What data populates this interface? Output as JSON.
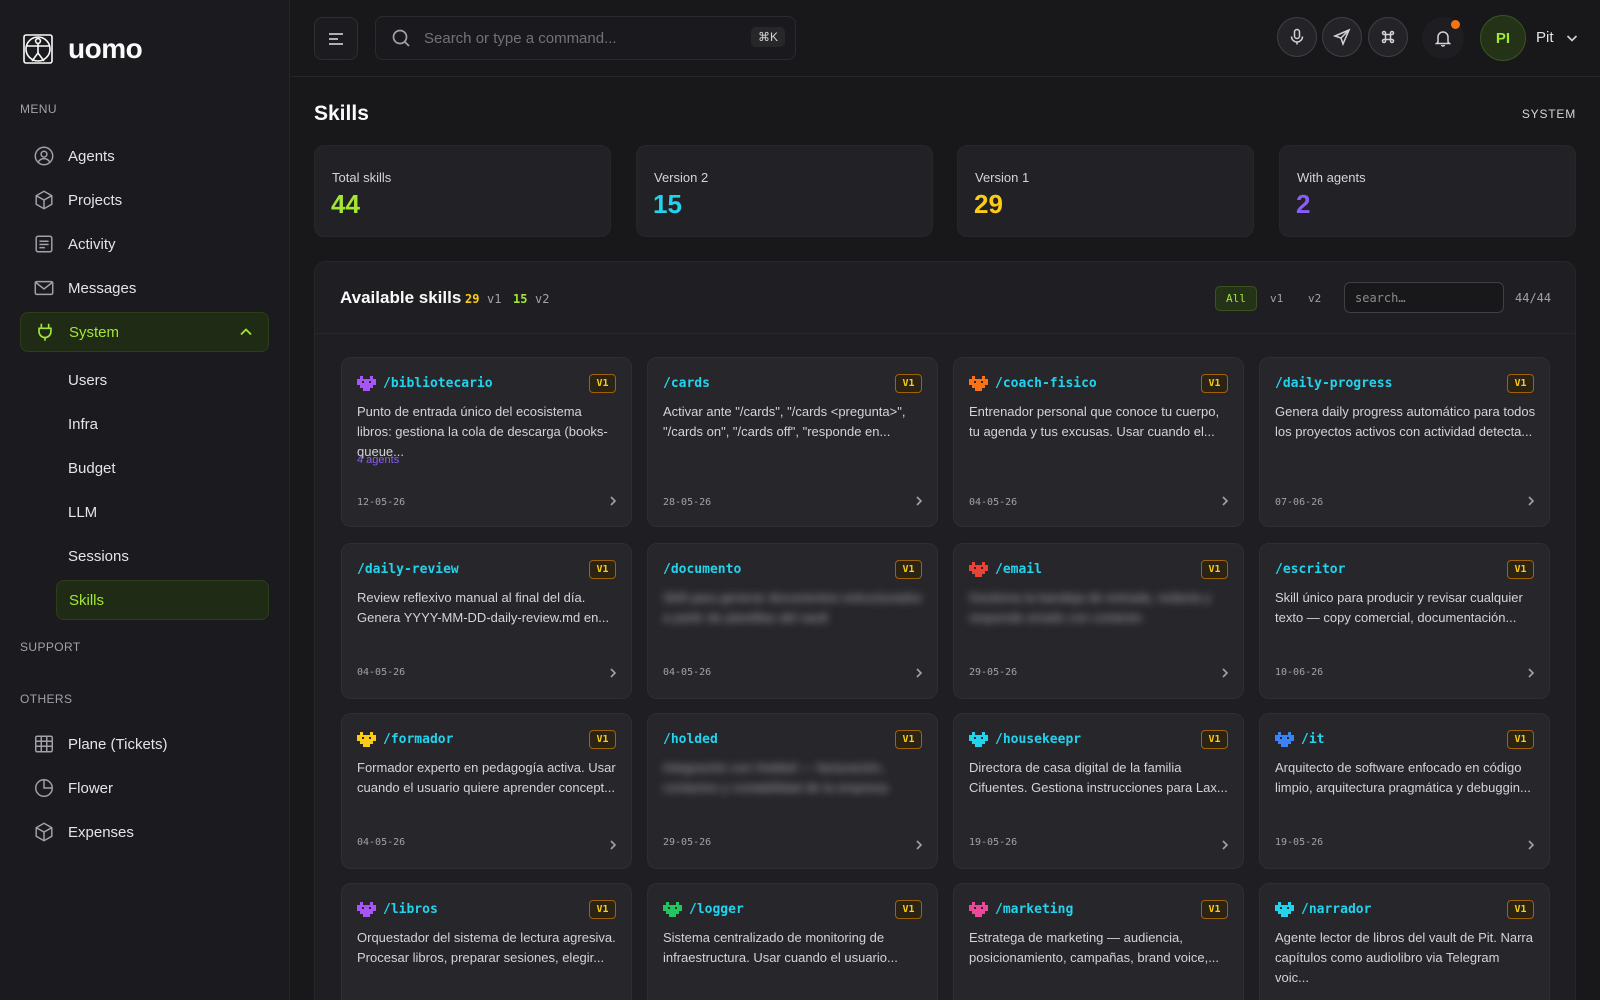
{
  "brand": {
    "name": "uomo"
  },
  "sidebar": {
    "menu_label": "MENU",
    "support_label": "SUPPORT",
    "others_label": "OTHERS",
    "items": [
      {
        "label": "Agents",
        "icon": "user-circle-icon"
      },
      {
        "label": "Projects",
        "icon": "box-icon"
      },
      {
        "label": "Activity",
        "icon": "list-icon"
      },
      {
        "label": "Messages",
        "icon": "mail-icon"
      },
      {
        "label": "System",
        "icon": "plug-icon",
        "expanded": true
      }
    ],
    "sub_items": [
      {
        "label": "Users"
      },
      {
        "label": "Infra"
      },
      {
        "label": "Budget"
      },
      {
        "label": "LLM"
      },
      {
        "label": "Sessions"
      },
      {
        "label": "Skills",
        "active": true
      }
    ],
    "others": [
      {
        "label": "Plane (Tickets)",
        "icon": "table-icon"
      },
      {
        "label": "Flower",
        "icon": "pie-chart-icon"
      },
      {
        "label": "Expenses",
        "icon": "box-icon"
      }
    ]
  },
  "header": {
    "search_placeholder": "Search or type a command...",
    "shortcut": "⌘K",
    "user_initials": "PI",
    "user_name": "Pit"
  },
  "page": {
    "title": "Skills",
    "section": "SYSTEM"
  },
  "stats": [
    {
      "label": "Total skills",
      "value": "44",
      "color": "#a3e635"
    },
    {
      "label": "Version 2",
      "value": "15",
      "color": "#22d3ee"
    },
    {
      "label": "Version 1",
      "value": "29",
      "color": "#facc15"
    },
    {
      "label": "With agents",
      "value": "2",
      "color": "#8b5cf6"
    }
  ],
  "panel": {
    "title": "Available skills",
    "v1_count": "29",
    "v1_label": "v1",
    "v2_count": "15",
    "v2_label": "v2",
    "filters": [
      "All",
      "v1",
      "v2"
    ],
    "search_placeholder": "search…",
    "result_count": "44/44"
  },
  "skills": [
    {
      "name": "/bibliotecario",
      "version": "V1",
      "desc": "Punto de entrada único del ecosistema libros: gestiona la cola de descarga (books-queue...",
      "agents": "4 agents",
      "date": "12-05-26",
      "icon_color": "#a855f7"
    },
    {
      "name": "/cards",
      "version": "V1",
      "desc": "Activar ante \"/cards\", \"/cards <pregunta>\", \"/cards on\", \"/cards off\", \"responde en...",
      "date": "28-05-26",
      "icon_color": ""
    },
    {
      "name": "/coach-fisico",
      "version": "V1",
      "desc": "Entrenador personal que conoce tu cuerpo, tu agenda y tus excusas. Usar cuando el...",
      "date": "04-05-26",
      "icon_color": "#f97316"
    },
    {
      "name": "/daily-progress",
      "version": "V1",
      "desc": "Genera daily progress automático para todos los proyectos activos con actividad detecta...",
      "date": "07-06-26",
      "icon_color": ""
    },
    {
      "name": "/daily-review",
      "version": "V1",
      "desc": "Review reflexivo manual al final del día. Genera YYYY-MM-DD-daily-review.md en...",
      "date": "04-05-26",
      "icon_color": ""
    },
    {
      "name": "/documento",
      "version": "V1",
      "desc": "Skill para generar documentos estructurados a partir de plantillas del vault",
      "blur": true,
      "date": "04-05-26",
      "icon_color": ""
    },
    {
      "name": "/email",
      "version": "V1",
      "desc": "Gestiona la bandeja de entrada, redacta y responde emails con contexto",
      "blur": true,
      "date": "29-05-26",
      "icon_color": "#ea4335"
    },
    {
      "name": "/escritor",
      "version": "V1",
      "desc": "Skill único para producir y revisar cualquier texto — copy comercial, documentación...",
      "date": "10-06-26",
      "icon_color": ""
    },
    {
      "name": "/formador",
      "version": "V1",
      "desc": "Formador experto en pedagogía activa. Usar cuando el usuario quiere aprender concept...",
      "date": "04-05-26",
      "icon_color": "#facc15"
    },
    {
      "name": "/holded",
      "version": "V1",
      "desc": "Integración con Holded — facturación, contactos y contabilidad de la empresa",
      "blur": true,
      "date": "29-05-26",
      "icon_color": ""
    },
    {
      "name": "/housekeepr",
      "version": "V1",
      "desc": "Directora de casa digital de la familia Cifuentes. Gestiona instrucciones para Lax...",
      "date": "19-05-26",
      "icon_color": "#22d3ee"
    },
    {
      "name": "/it",
      "version": "V1",
      "desc": "Arquitecto de software enfocado en código limpio, arquitectura pragmática y debuggin...",
      "date": "19-05-26",
      "icon_color": "#3b82f6"
    },
    {
      "name": "/libros",
      "version": "V1",
      "desc": "Orquestador del sistema de lectura agresiva. Procesar libros, preparar sesiones, elegir...",
      "date": "",
      "icon_color": "#a855f7"
    },
    {
      "name": "/logger",
      "version": "V1",
      "desc": "Sistema centralizado de monitoring de infraestructura. Usar cuando el usuario...",
      "date": "",
      "icon_color": "#22c55e"
    },
    {
      "name": "/marketing",
      "version": "V1",
      "desc": "Estratega de marketing — audiencia, posicionamiento, campañas, brand voice,...",
      "date": "",
      "icon_color": "#ec4899"
    },
    {
      "name": "/narrador",
      "version": "V1",
      "desc": "Agente lector de libros del vault de Pit. Narra capítulos como audiolibro via Telegram voic...",
      "date": "",
      "icon_color": "#22d3ee"
    }
  ]
}
